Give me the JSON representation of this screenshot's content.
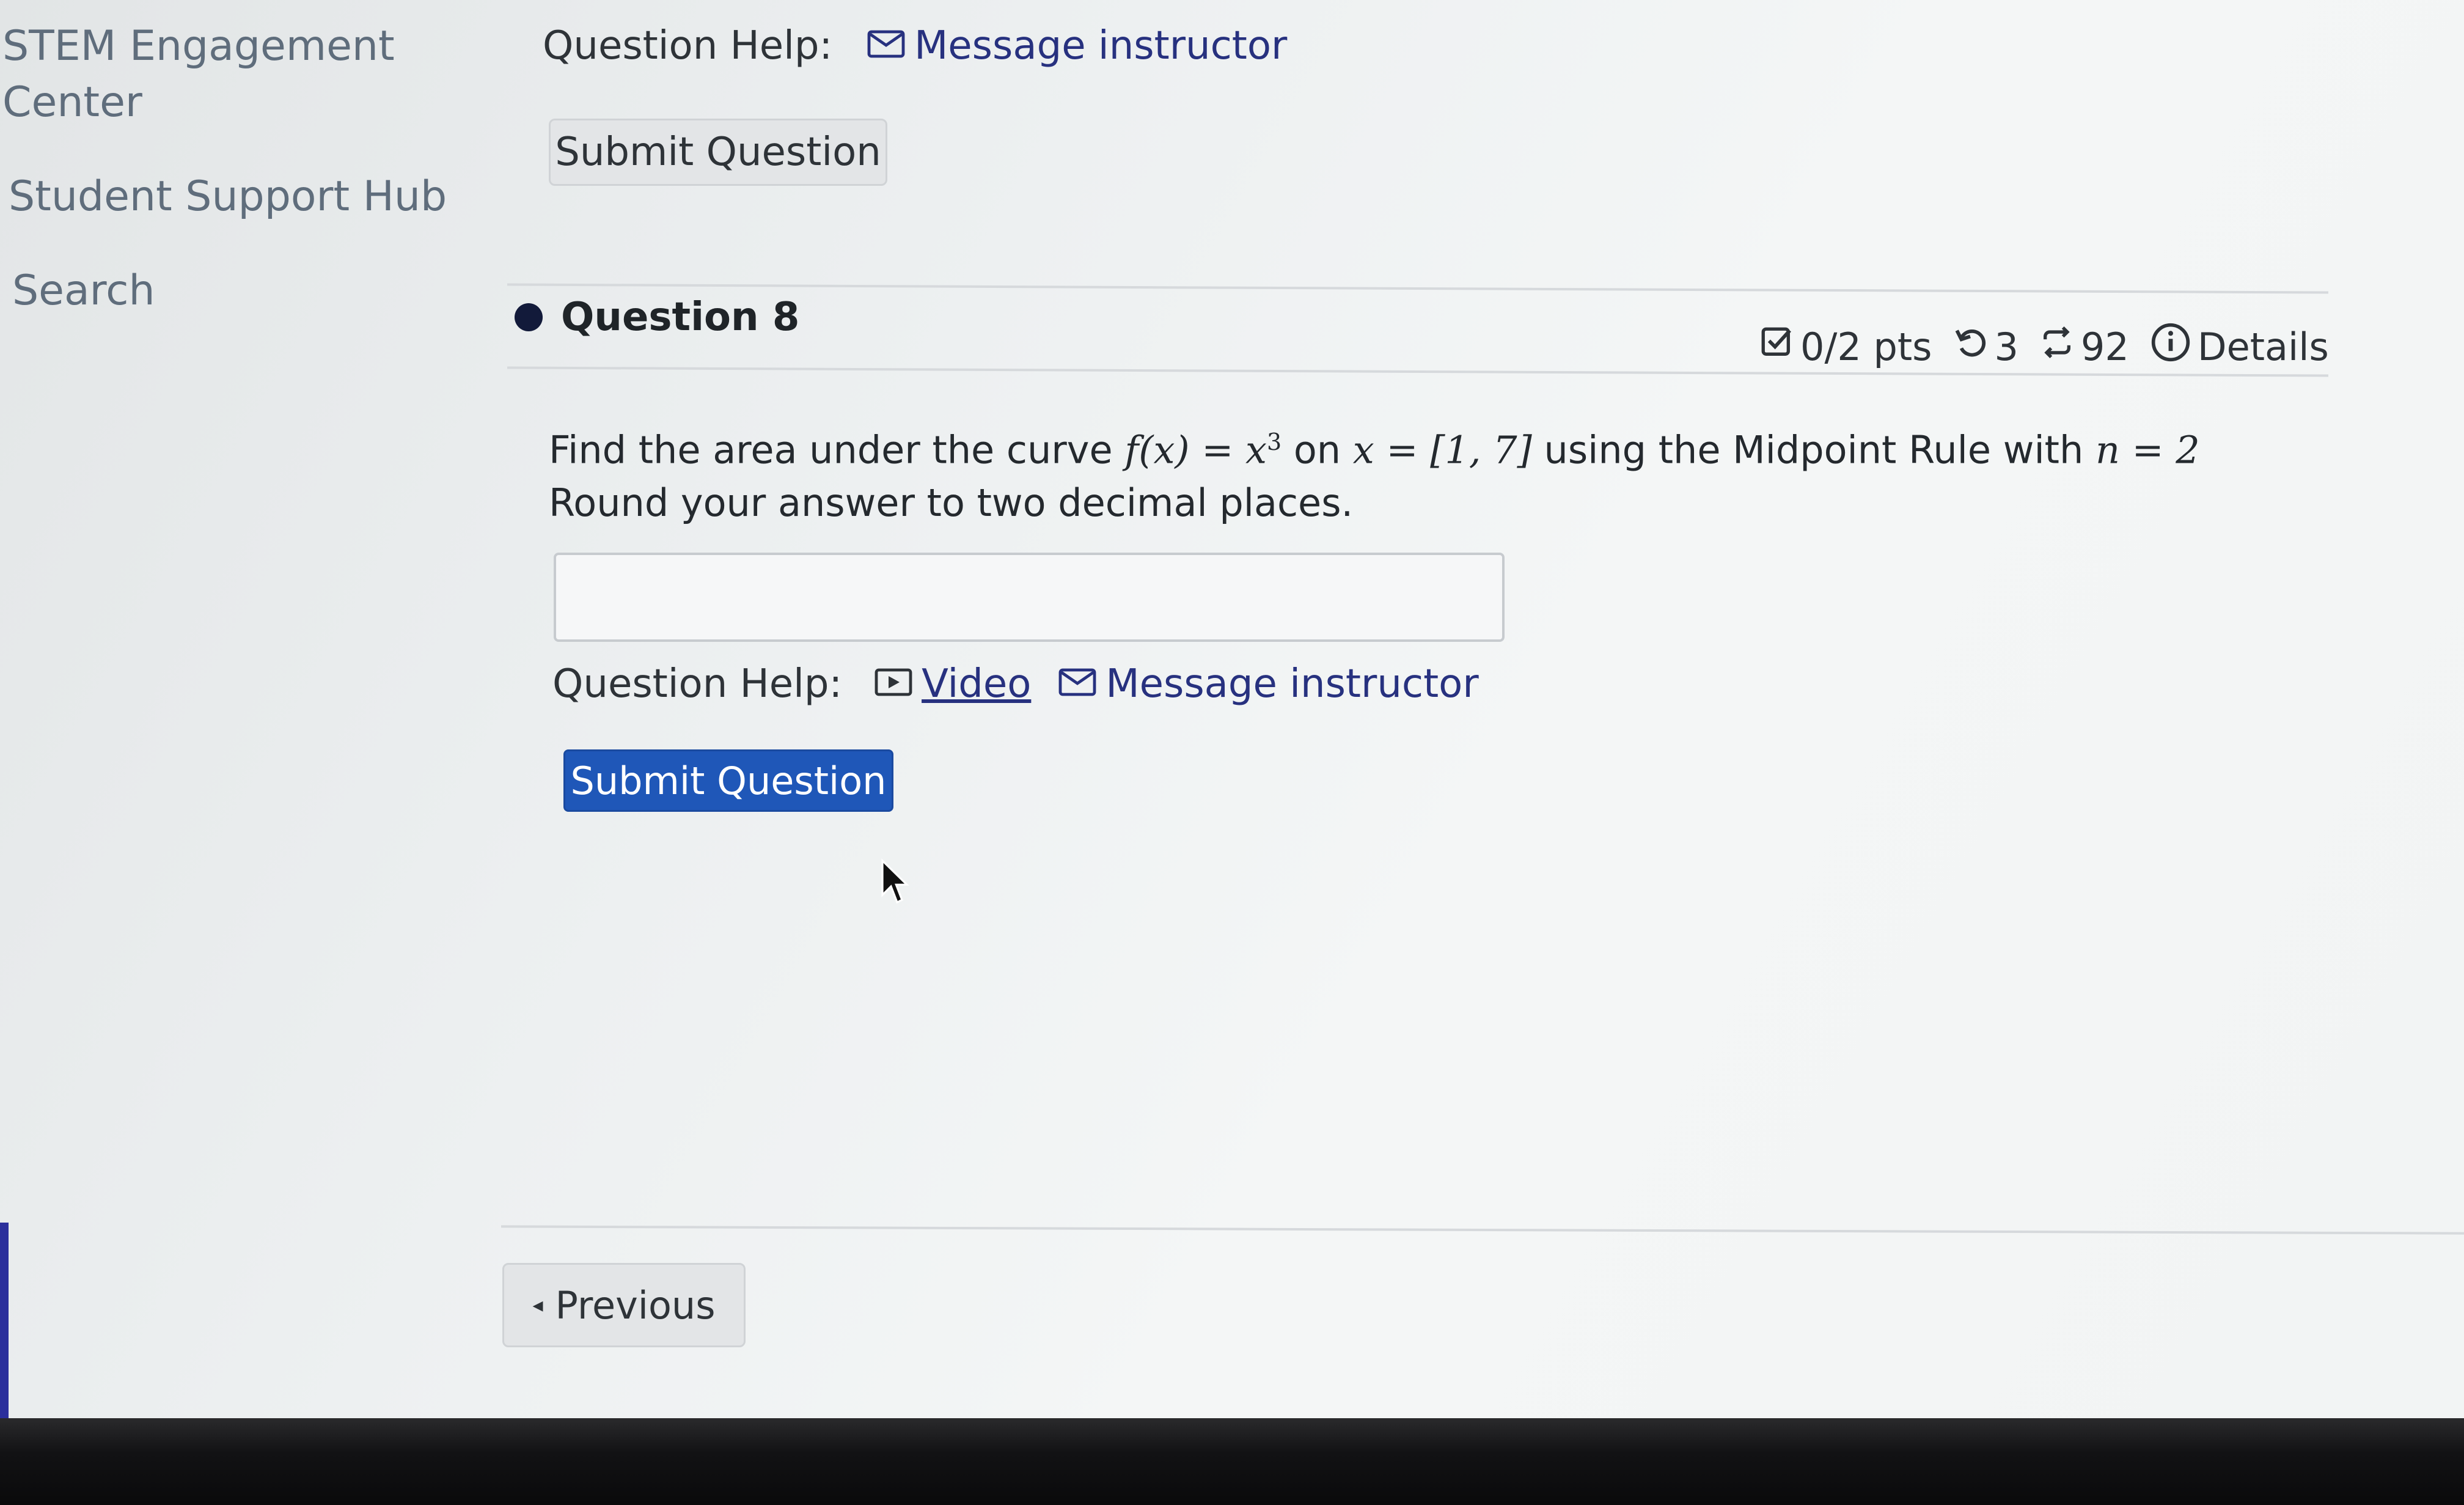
{
  "sidebar": {
    "items": [
      {
        "label_line1": "STEM Engagement",
        "label_line2": "Center"
      },
      {
        "label": "Student Support Hub"
      },
      {
        "label": "Search"
      }
    ]
  },
  "previous_question_area": {
    "help_label": "Question Help:",
    "message_link": "Message instructor",
    "submit_label": "Submit Question"
  },
  "question": {
    "title": "Question 8",
    "points": "0/2 pts",
    "retries": "3",
    "attempts": "92",
    "details_label": "Details",
    "text_before": "Find the area under the curve ",
    "func_lhs": "f(x) = x",
    "func_exp": "3",
    "text_on": " on ",
    "interval": "x = [1, 7]",
    "text_mid": " using the Midpoint Rule with ",
    "n_expr": "n = 2",
    "text_after": " Round your answer to two decimal places.",
    "answer_value": "",
    "help_label": "Question Help:",
    "video_link": "Video",
    "message_link": "Message instructor",
    "submit_label": "Submit Question"
  },
  "navigation": {
    "previous_label": "Previous"
  },
  "colors": {
    "primary_button": "#1f57b8",
    "link": "#27317f"
  }
}
